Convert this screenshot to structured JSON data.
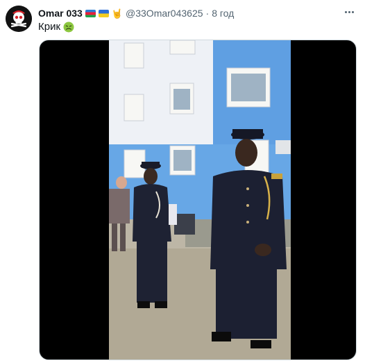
{
  "post": {
    "display_name": "Omar 033",
    "handle": "@33Omar043625",
    "separator": "·",
    "time": "8 год",
    "text": "Крик",
    "flags": [
      "azerbaijan-flag",
      "ukraine-flag"
    ],
    "text_emoji": "nauseated-face-emoji"
  },
  "colors": {
    "secondary_text": "#536471",
    "primary_text": "#0f1419",
    "media_border": "#cfd9de",
    "building_blue": "#5d9ee0",
    "building_white": "#eef1f6"
  }
}
